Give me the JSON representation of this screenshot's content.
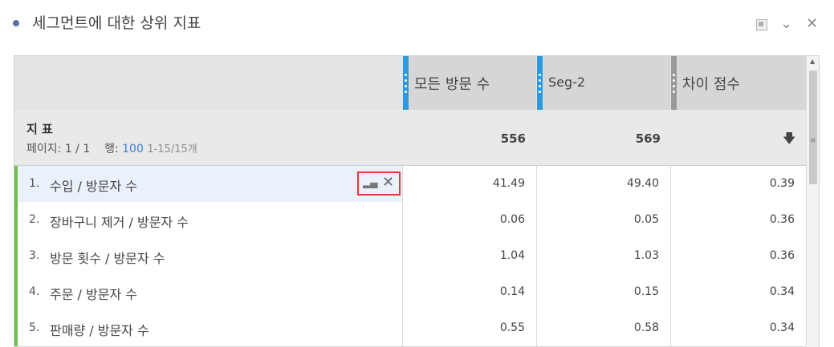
{
  "panel": {
    "title": "세그먼트에 대한 상위 지표",
    "icons": {
      "maximize": "maximize-icon",
      "collapse": "chevron-down-icon",
      "close": "close-icon"
    }
  },
  "columns": [
    {
      "label": "모든 방문 수",
      "accent": "#2a9ae0"
    },
    {
      "label": "Seg-2",
      "accent": "#2a9ae0"
    },
    {
      "label": "차이 점수",
      "accent": "#999999"
    }
  ],
  "summary": {
    "title": "지 표",
    "page_label": "페이지:",
    "page_value": "1 / 1",
    "rows_label": "행:",
    "rows_value": "100",
    "range": "1-15/15개",
    "totals": [
      "556",
      "569"
    ],
    "sort_icon": "sort-down-arrow-icon"
  },
  "rows": [
    {
      "rank": "1.",
      "name": "수입 / 방문자 수",
      "values": [
        "41.49",
        "49.40",
        "0.39"
      ],
      "selected": true
    },
    {
      "rank": "2.",
      "name": "장바구니 제거 / 방문자 수",
      "values": [
        "0.06",
        "0.05",
        "0.36"
      ]
    },
    {
      "rank": "3.",
      "name": "방문 횟수 / 방문자 수",
      "values": [
        "1.04",
        "1.03",
        "0.36"
      ]
    },
    {
      "rank": "4.",
      "name": "주문 / 방문자 수",
      "values": [
        "0.14",
        "0.15",
        "0.34"
      ]
    },
    {
      "rank": "5.",
      "name": "판매량 / 방문자 수",
      "values": [
        "0.55",
        "0.58",
        "0.34"
      ]
    }
  ],
  "colors": {
    "row_accent": "#6cc04a",
    "highlight_box": "#e03a3a",
    "link_blue": "#3b7fd4"
  }
}
